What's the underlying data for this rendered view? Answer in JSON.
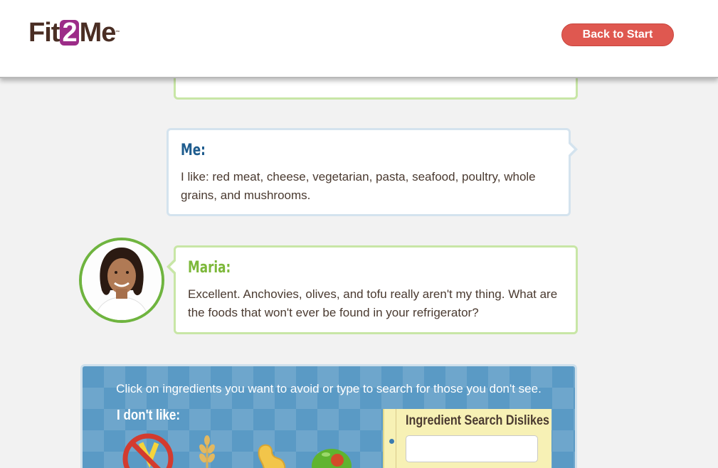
{
  "header": {
    "logo_prefix": "Fit",
    "logo_two": "2",
    "logo_suffix": "Me",
    "back_button": "Back to Start"
  },
  "conversation": {
    "me": {
      "speaker": "Me:",
      "message": "I like: red meat, cheese, vegetarian, pasta, seafood, poultry, whole grains, and mushrooms."
    },
    "maria": {
      "speaker": "Maria:",
      "message": "Excellent. Anchovies, olives, and tofu really aren't my thing. What are the foods that won't ever be found in your refrigerator?"
    }
  },
  "ingredients": {
    "instructions": "Click on ingredients you want to avoid or type to search for those you don't see.",
    "dislike_label": "I don't like:",
    "items": [
      "no-dislikes-icon",
      "wheat-icon",
      "peanut-icon",
      "olive-icon"
    ],
    "search": {
      "title": "Ingredient Search Dislikes",
      "value": ""
    }
  },
  "colors": {
    "maria_accent": "#7db83a",
    "me_accent": "#1e5c8e",
    "button": "#df5850",
    "panel": "#5a9ac5"
  }
}
